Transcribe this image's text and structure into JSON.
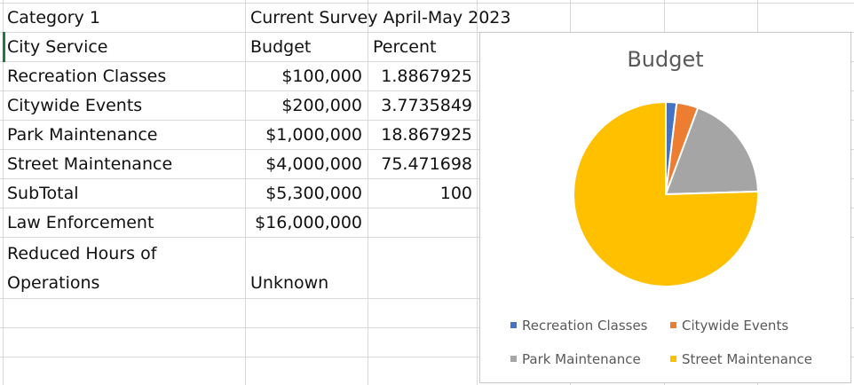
{
  "sheet": {
    "header": {
      "category": "Category 1",
      "survey": "Current Survey April-May 2023"
    },
    "columns": {
      "service": "City Service",
      "budget": "Budget",
      "percent": "Percent"
    },
    "rows": [
      {
        "service": "Recreation Classes",
        "budget": "$100,000",
        "percent": "1.8867925"
      },
      {
        "service": "Citywide Events",
        "budget": "$200,000",
        "percent": "3.7735849"
      },
      {
        "service": "Park Maintenance",
        "budget": "$1,000,000",
        "percent": "18.867925"
      },
      {
        "service": "Street Maintenance",
        "budget": "$4,000,000",
        "percent": "75.471698"
      },
      {
        "service": "SubTotal",
        "budget": "$5,300,000",
        "percent": "100"
      },
      {
        "service": "Law Enforcement",
        "budget": "$16,000,000",
        "percent": ""
      }
    ],
    "reduced": {
      "line1": "Reduced Hours of",
      "line2": "Operations",
      "budget": "Unknown"
    }
  },
  "chart_data": {
    "type": "pie",
    "title": "Budget",
    "categories": [
      "Recreation Classes",
      "Citywide Events",
      "Park Maintenance",
      "Street Maintenance"
    ],
    "values": [
      100000,
      200000,
      1000000,
      4000000
    ],
    "colors": [
      "#4472c4",
      "#ed7d31",
      "#a5a5a5",
      "#ffc000"
    ],
    "legend_position": "bottom"
  }
}
